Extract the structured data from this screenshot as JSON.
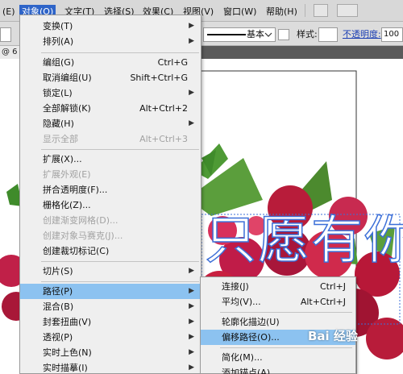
{
  "menubar": {
    "items": [
      "(E)",
      "对象(O)",
      "文字(T)",
      "选择(S)",
      "效果(C)",
      "视图(V)",
      "窗口(W)",
      "帮助(H)"
    ],
    "active_index": 1
  },
  "control_bar": {
    "stroke_style_label": "基本",
    "style_label": "样式:",
    "opacity_label": "不透明度:",
    "opacity_value": "100"
  },
  "tab": {
    "label": "@ 6"
  },
  "canvas": {
    "artwork_text": "只愿有你"
  },
  "object_menu": {
    "items": [
      {
        "label": "变换(T)",
        "shortcut": "",
        "submenu": true,
        "disabled": false
      },
      {
        "label": "排列(A)",
        "shortcut": "",
        "submenu": true,
        "disabled": false
      },
      {
        "label": "编组(G)",
        "shortcut": "Ctrl+G",
        "submenu": false,
        "disabled": false
      },
      {
        "label": "取消编组(U)",
        "shortcut": "Shift+Ctrl+G",
        "submenu": false,
        "disabled": false
      },
      {
        "label": "锁定(L)",
        "shortcut": "",
        "submenu": true,
        "disabled": false
      },
      {
        "label": "全部解锁(K)",
        "shortcut": "Alt+Ctrl+2",
        "submenu": false,
        "disabled": false
      },
      {
        "label": "隐藏(H)",
        "shortcut": "",
        "submenu": true,
        "disabled": false
      },
      {
        "label": "显示全部",
        "shortcut": "Alt+Ctrl+3",
        "submenu": false,
        "disabled": true
      },
      {
        "label": "扩展(X)...",
        "shortcut": "",
        "submenu": false,
        "disabled": false
      },
      {
        "label": "扩展外观(E)",
        "shortcut": "",
        "submenu": false,
        "disabled": true
      },
      {
        "label": "拼合透明度(F)...",
        "shortcut": "",
        "submenu": false,
        "disabled": false
      },
      {
        "label": "栅格化(Z)...",
        "shortcut": "",
        "submenu": false,
        "disabled": false
      },
      {
        "label": "创建渐变网格(D)...",
        "shortcut": "",
        "submenu": false,
        "disabled": true
      },
      {
        "label": "创建对象马赛克(J)...",
        "shortcut": "",
        "submenu": false,
        "disabled": true
      },
      {
        "label": "创建裁切标记(C)",
        "shortcut": "",
        "submenu": false,
        "disabled": false
      },
      {
        "label": "切片(S)",
        "shortcut": "",
        "submenu": true,
        "disabled": false
      },
      {
        "label": "路径(P)",
        "shortcut": "",
        "submenu": true,
        "disabled": false
      },
      {
        "label": "混合(B)",
        "shortcut": "",
        "submenu": true,
        "disabled": false
      },
      {
        "label": "封套扭曲(V)",
        "shortcut": "",
        "submenu": true,
        "disabled": false
      },
      {
        "label": "透视(P)",
        "shortcut": "",
        "submenu": true,
        "disabled": false
      },
      {
        "label": "实时上色(N)",
        "shortcut": "",
        "submenu": true,
        "disabled": false
      },
      {
        "label": "实时描摹(I)",
        "shortcut": "",
        "submenu": true,
        "disabled": false
      }
    ],
    "highlighted_index": 16
  },
  "path_submenu": {
    "items": [
      {
        "label": "连接(J)",
        "shortcut": "Ctrl+J"
      },
      {
        "label": "平均(V)...",
        "shortcut": "Alt+Ctrl+J"
      },
      {
        "label": "轮廓化描边(U)",
        "shortcut": ""
      },
      {
        "label": "偏移路径(O)...",
        "shortcut": ""
      },
      {
        "label": "简化(M)...",
        "shortcut": ""
      },
      {
        "label": "添加锚点(A)",
        "shortcut": ""
      }
    ],
    "highlighted_index": 3
  },
  "watermark": {
    "text": "Bai 经验"
  }
}
